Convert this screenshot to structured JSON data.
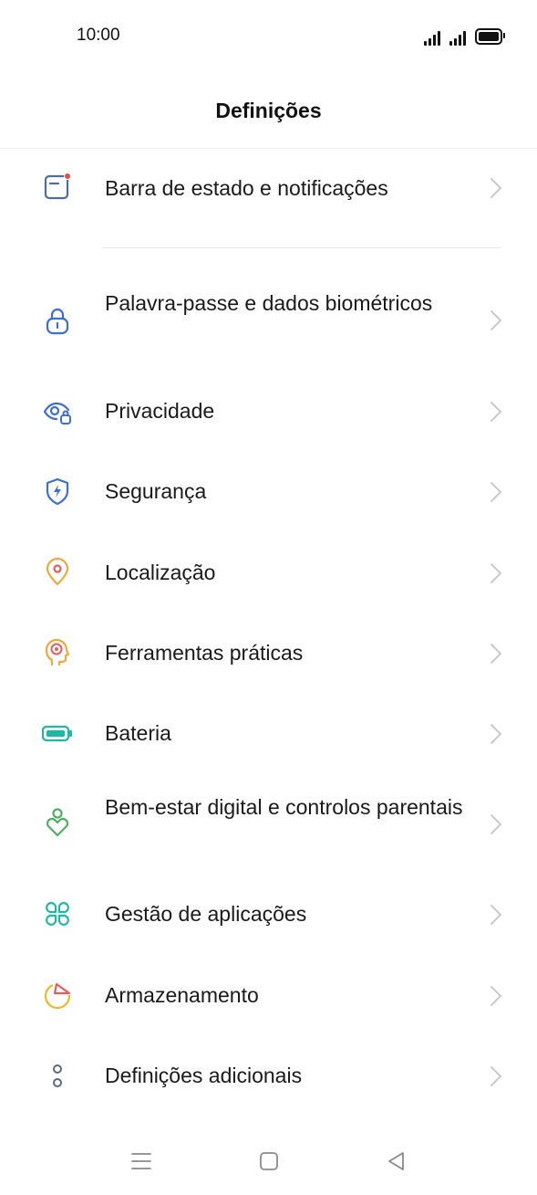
{
  "status_bar": {
    "time": "10:00"
  },
  "header": {
    "title": "Definições"
  },
  "items": [
    {
      "label": "Barra de estado e notificações",
      "icon": "notification-bar-icon",
      "color": "#4a6fa5"
    },
    {
      "label": "Palavra-passe e dados biométricos",
      "icon": "lock-icon",
      "color": "#3d6fd8"
    },
    {
      "label": "Privacidade",
      "icon": "privacy-eye-icon",
      "color": "#3d6fd8"
    },
    {
      "label": "Segurança",
      "icon": "shield-icon",
      "color": "#3d6fd8"
    },
    {
      "label": "Localização",
      "icon": "location-pin-icon",
      "color": "#f0a93a"
    },
    {
      "label": "Ferramentas práticas",
      "icon": "tools-head-icon",
      "color": "#f0a93a"
    },
    {
      "label": "Bateria",
      "icon": "battery-icon",
      "color": "#1fb8a3"
    },
    {
      "label": "Bem-estar digital e controlos parentais",
      "icon": "wellbeing-icon",
      "color": "#4caf63"
    },
    {
      "label": "Gestão de aplicações",
      "icon": "apps-grid-icon",
      "color": "#1fb8a3"
    },
    {
      "label": "Armazenamento",
      "icon": "storage-pie-icon",
      "color": "#f2b824"
    },
    {
      "label": "Definições adicionais",
      "icon": "more-settings-icon",
      "color": "#5a6b85"
    }
  ],
  "nav_bar": {
    "menu_icon": "menu-icon",
    "home_icon": "home-icon",
    "back_icon": "back-icon"
  }
}
